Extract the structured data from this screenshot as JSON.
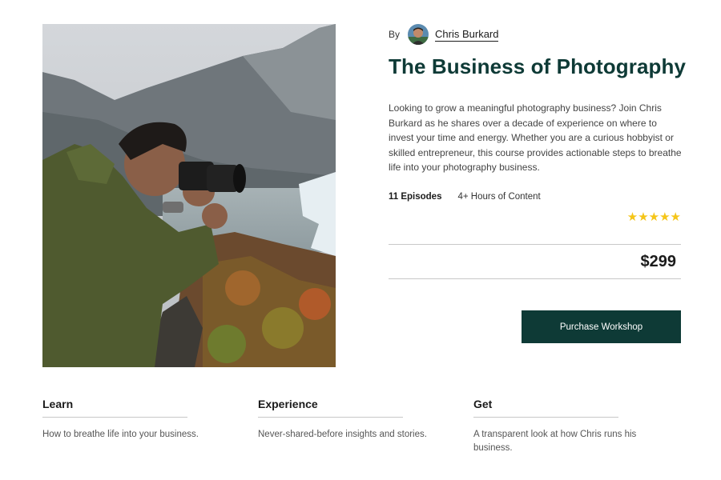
{
  "hero": {
    "image_desc_icon": "photographer-photo"
  },
  "author": {
    "by_label": "By",
    "name": "Chris Burkard"
  },
  "course": {
    "title": "The Business of Photography",
    "description": "Looking to grow a meaningful photography business? Join Chris Burkard as he shares over a decade of experience on where to invest your time and energy. Whether you are a curious hobbyist or skilled entrepreneur, this course provides actionable steps to breathe life into your photography business.",
    "episodes": "11 Episodes",
    "hours": "4+ Hours of Content",
    "rating_stars": 5,
    "price": "$299",
    "purchase_label": "Purchase Workshop"
  },
  "features": [
    {
      "title": "Learn",
      "text": "How to breathe life into your business."
    },
    {
      "title": "Experience",
      "text": "Never-shared-before insights and stories."
    },
    {
      "title": "Get",
      "text": "A transparent look at how Chris runs his business."
    }
  ],
  "colors": {
    "brand": "#0e3a36",
    "star": "#f5c518",
    "divider": "#c8c8c8"
  }
}
